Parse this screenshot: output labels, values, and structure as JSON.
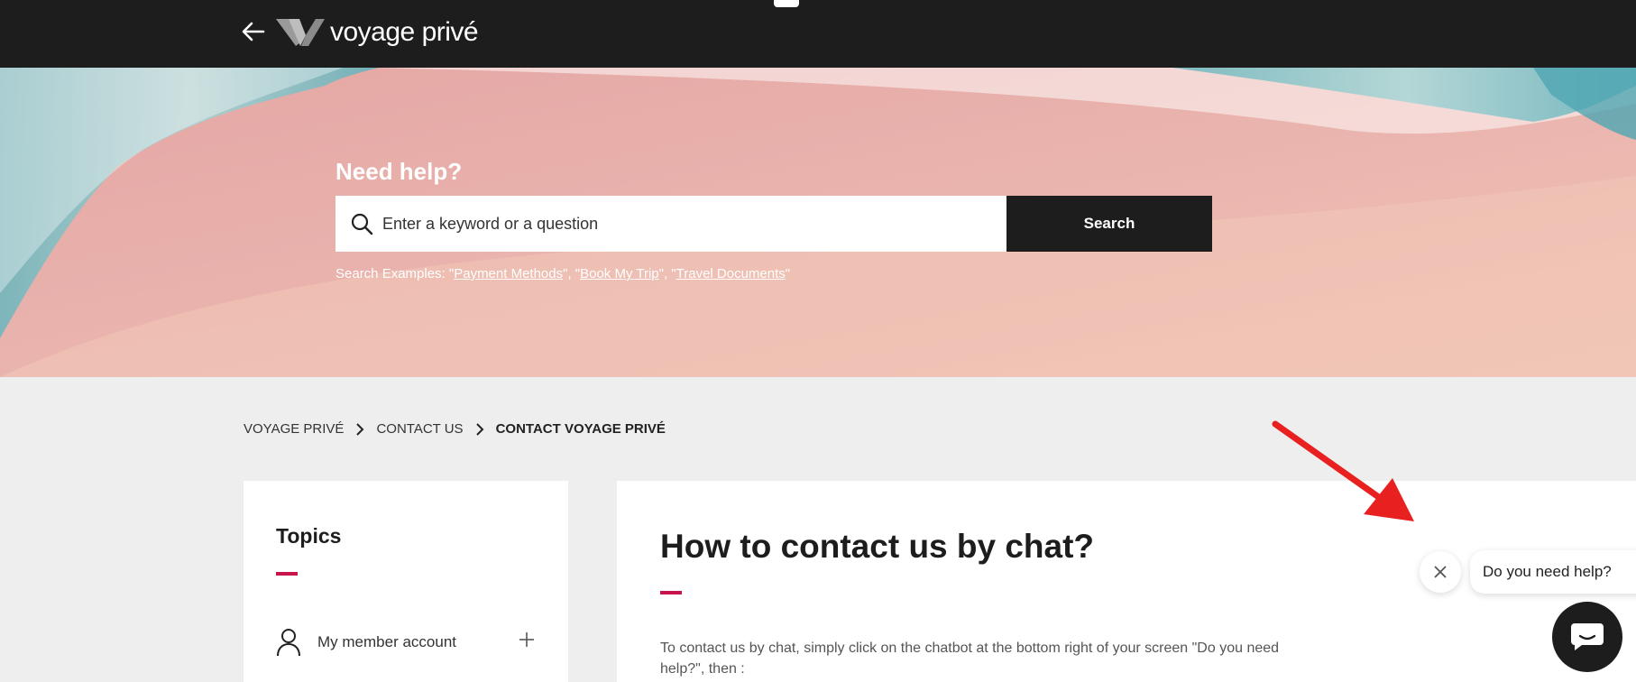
{
  "header": {
    "logo_text": "voyage privé",
    "back_icon": "arrow-left-icon"
  },
  "hero": {
    "heading": "Need help?",
    "search_placeholder": "Enter a keyword or a question",
    "search_button": "Search",
    "examples_prefix": "Search Examples: \"",
    "examples": [
      "Payment Methods",
      "Book My Trip",
      "Travel Documents"
    ],
    "examples_sep": "\", \"",
    "examples_suffix": "\""
  },
  "breadcrumb": {
    "items": [
      "VOYAGE PRIVÉ",
      "CONTACT US",
      "CONTACT VOYAGE PRIVÉ"
    ]
  },
  "sidebar": {
    "title": "Topics",
    "items": [
      {
        "label": "My member account",
        "icon": "user-icon"
      }
    ]
  },
  "article": {
    "title": "How to contact us by chat?",
    "body": "To contact us by chat, simply click on the chatbot at the bottom right of your screen \"Do you need help?\", then :"
  },
  "chat_widget": {
    "prompt": "Do you need help?",
    "close_icon": "close-icon",
    "launcher_icon": "chat-icon"
  },
  "colors": {
    "accent": "#c8144b",
    "dark": "#1d1d1d",
    "annotation_arrow": "#e8201f"
  }
}
